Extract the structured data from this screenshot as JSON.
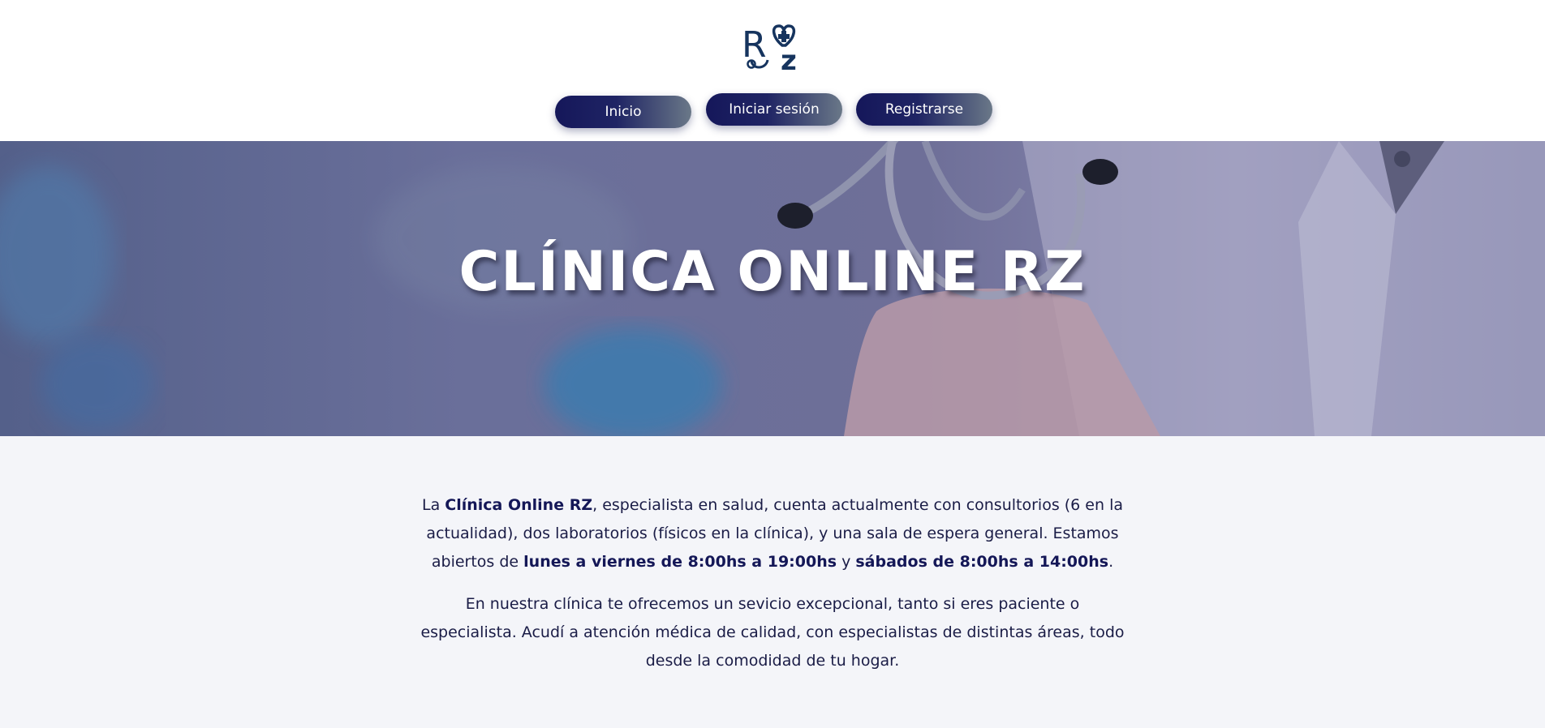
{
  "logo": {
    "text": "RZ",
    "icon": "heart-stethoscope-icon",
    "color": "#16345e"
  },
  "nav": {
    "items": [
      {
        "label": "Inicio"
      },
      {
        "label": "Iniciar sesión"
      },
      {
        "label": "Registrarse"
      }
    ],
    "gradient_start": "#15175a",
    "gradient_end": "#6a7888"
  },
  "hero": {
    "title": "CLÍNICA ONLINE RZ",
    "overlay_color": "#6a6f9a"
  },
  "about": {
    "p1": {
      "t1": "La ",
      "b1": "Clínica Online RZ",
      "t2": ", especialista en salud, cuenta actualmente con consultorios (6 en la actualidad), dos laboratorios (físicos en la clínica), y una sala de espera general. Estamos abiertos de ",
      "b2": "lunes a viernes de 8:00hs a 19:00hs",
      "t3": " y ",
      "b3": "sábados de 8:00hs a 14:00hs",
      "t4": "."
    },
    "p2": "En nuestra clínica te ofrecemos un sevicio excepcional, tanto si eres paciente o especialista. Acudí a atención médica de calidad, con especialistas de distintas áreas, todo desde la comodidad de tu hogar."
  }
}
